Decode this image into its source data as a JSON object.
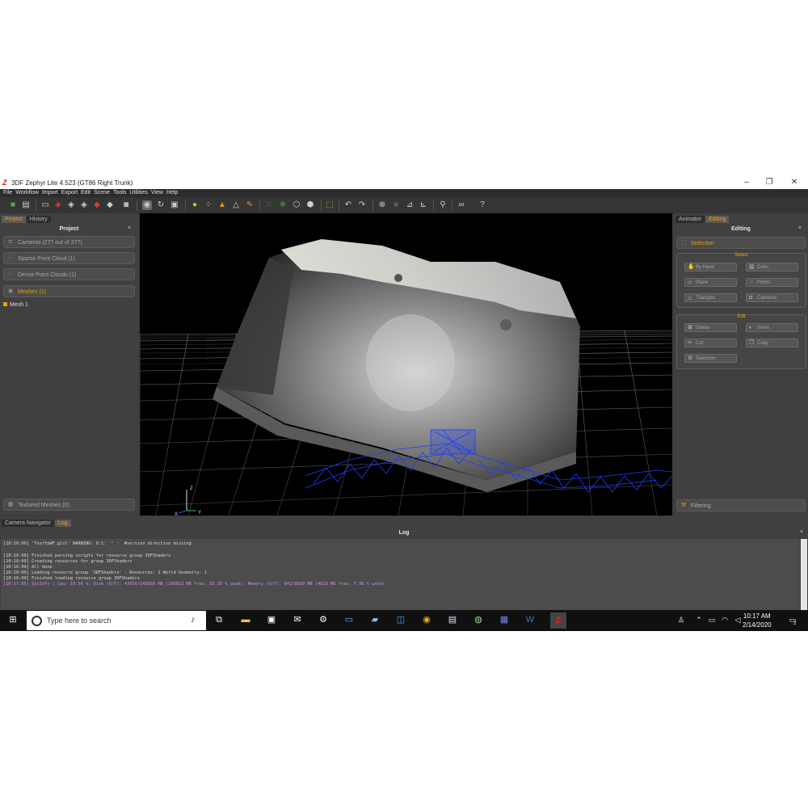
{
  "window": {
    "title": "3DF Zephyr Lite 4.523 (GT86 Right Trunk)",
    "logo": "Z"
  },
  "menu": [
    "File",
    "Workflow",
    "Import",
    "Export",
    "Edit",
    "Scene",
    "Tools",
    "Utilities",
    "View",
    "Help"
  ],
  "left_panel": {
    "tabs": [
      "Project",
      "History"
    ],
    "title": "Project",
    "close": "×",
    "items": [
      {
        "label": "Cameras (277 out of 277)",
        "icon": "camera-icon"
      },
      {
        "label": "Sparse Point Cloud (1)",
        "icon": "sparse-cloud-icon"
      },
      {
        "label": "Dense Point Clouds (1)",
        "icon": "dense-cloud-icon"
      },
      {
        "label": "Meshes (1)",
        "icon": "mesh-icon"
      }
    ],
    "mesh_item": "Mesh 1",
    "textured": "Textured Meshes (0)"
  },
  "right_panel": {
    "tabs": [
      "Animator",
      "Editing"
    ],
    "title": "Editing",
    "close": "×",
    "selection_tool": "Selection",
    "select_group": "Select",
    "select_buttons": [
      "By Hand",
      "Color",
      "Plane",
      "Points",
      "Triangles",
      "Cameras"
    ],
    "edit_group": "Edit",
    "edit_buttons": [
      "Delete",
      "Invert",
      "Cut",
      "Copy",
      "Selection"
    ],
    "filtering": "Filtering"
  },
  "viewport": {
    "axis_z": "Z",
    "axis_y": "Y",
    "axis_x": "X"
  },
  "bottom": {
    "tabs": [
      "Camera Navigator",
      "Log"
    ],
    "title": "Log",
    "close": "×",
    "lines": [
      "[10:16:09] 'TestfpWF.glsl' WARNING: 0:1: '' :  #version directive missing",
      "[10:16:09] Finished parsing scripts for resource group 3DFShaders",
      "[10:16:09] Creating resources for group 3DFShaders",
      "[10:16:09] All done",
      "[10:16:09] Loading resource group '3DFShaders' - Resources: 1 World Geometry: 1",
      "[10:16:09] Finished loading resource group 3DFShaders",
      "[10:17:05] SysInfo | Cpu: 10.56 %; Disk (U/T): 47656/243056 MB (196022 MB free, 19.35 % used); Memory (U/T): 642/8039 MB (4818 MB free, 7.99 % used)"
    ]
  },
  "taskbar": {
    "search_placeholder": "Type here to search",
    "time": "10:17 AM",
    "date": "2/14/2020",
    "notifications": "2",
    "pinned": [
      "task-view-icon",
      "file-explorer-icon",
      "store-icon",
      "mail-icon",
      "settings-icon",
      "app-icon-1",
      "app-icon-2",
      "app-icon-3",
      "chrome-icon",
      "app-icon-4",
      "app-icon-5",
      "teams-icon",
      "word-icon",
      "zephyr-icon"
    ]
  }
}
